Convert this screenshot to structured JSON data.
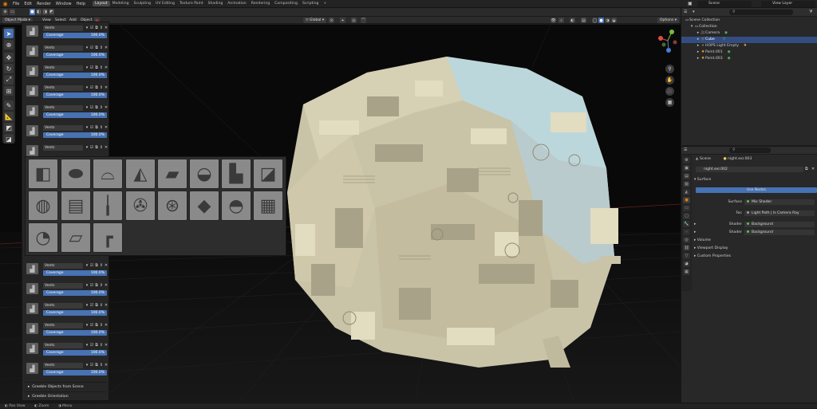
{
  "menus": [
    "File",
    "Edit",
    "Render",
    "Window",
    "Help"
  ],
  "workspaces": [
    "Layout",
    "Modeling",
    "Sculpting",
    "UV Editing",
    "Texture Paint",
    "Shading",
    "Animation",
    "Rendering",
    "Compositing",
    "Scripting"
  ],
  "active_workspace": "Layout",
  "scene_name": "Scene",
  "view_layer": "View Layer",
  "header": {
    "mode": "Object Mode",
    "view": "View",
    "select": "Select",
    "add": "Add",
    "object": "Object",
    "transform": "Global",
    "options": "Options"
  },
  "left_panel": {
    "item_name": "Vents",
    "coverage_label": "Coverage",
    "coverage_value": "100.0%",
    "collapsed": [
      "Greeble Objects from Scene",
      "Greeble Orientation"
    ]
  },
  "outliner": {
    "root": "Scene Collection",
    "collection": "Collection",
    "items": [
      {
        "name": "Camera",
        "selected": false
      },
      {
        "name": "Cube",
        "selected": true
      },
      {
        "name": "HOPS Light Empty",
        "selected": false
      },
      {
        "name": "Point.001",
        "selected": false
      },
      {
        "name": "Point.003",
        "selected": false
      }
    ]
  },
  "properties": {
    "breadcrumb_scene": "Scene",
    "breadcrumb_world": "night.exr.003",
    "world_field": "night.exr.002",
    "surface_section": "Surface",
    "use_nodes": "Use Nodes",
    "rows": [
      {
        "label": "Surface",
        "value": "Mix Shader"
      },
      {
        "label": "Fac",
        "value": "Light Path | Is Camera Ray"
      },
      {
        "label": "Shader",
        "value": "Background"
      },
      {
        "label": "Shader",
        "value": "Background"
      }
    ],
    "sections": [
      "Volume",
      "Viewport Display",
      "Custom Properties"
    ]
  },
  "status": {
    "left": "Pan View",
    "mid": "Zoom",
    "right": "Menu"
  }
}
